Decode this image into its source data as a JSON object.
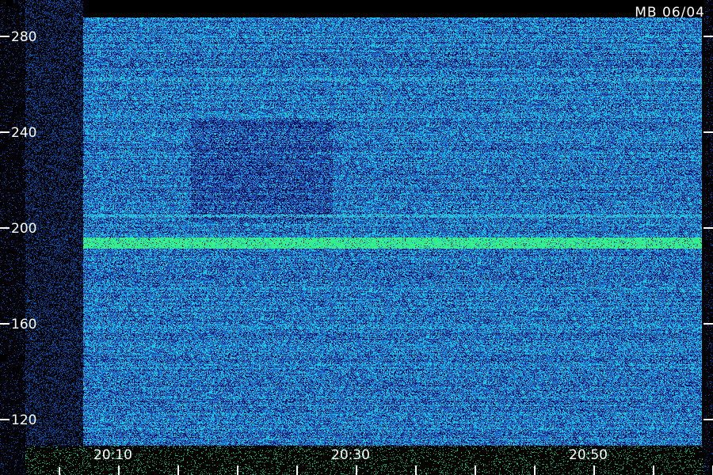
{
  "station_label": "MB 06/04",
  "colors": {
    "background": "#000000",
    "field_low": "#0a1a6e",
    "field_mid": "#2a6ad8",
    "field_high": "#38c8e8",
    "echo": "#3ef08a",
    "axis": "#ffffff"
  },
  "chart_data": {
    "type": "heatmap",
    "title": "",
    "xlabel": "",
    "ylabel": "",
    "x_ticks": [
      "20:10",
      "20:30",
      "20:50"
    ],
    "x_tick_minutes": [
      10,
      30,
      50
    ],
    "xlim_minutes": [
      9,
      61
    ],
    "minor_tick_interval_minutes": 5,
    "y_ticks": [
      120,
      160,
      200,
      240,
      280
    ],
    "ylim": [
      95,
      300
    ],
    "grid": false,
    "bands": [
      {
        "y": 194,
        "intensity": "strong",
        "color": "#3ef08a"
      },
      {
        "y": 205,
        "intensity": "medium",
        "color": "#38c8e8"
      },
      {
        "y": 262,
        "intensity": "faint",
        "color": "#38c8e8"
      }
    ]
  }
}
